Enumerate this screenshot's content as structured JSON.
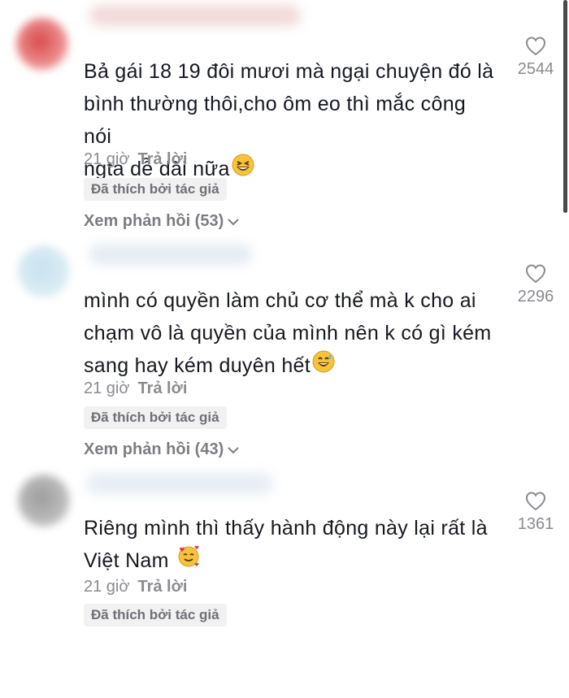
{
  "colors": {
    "text": "#161823",
    "muted": "#8a8b91",
    "badge_bg": "#f1f1f2",
    "badge_text": "#6f7076"
  },
  "comments": [
    {
      "text_lines": [
        "Bả gái 18 19 đôi mươi mà ngại chuyện đó là",
        "bình thường thôi,cho ôm eo thì mắc công nói",
        "ngta dễ dãi nữa"
      ],
      "emoji": "grinning-squinting-face",
      "time": "21 giờ",
      "reply_label": "Trả lời",
      "badge": "Đã thích bởi tác giả",
      "view_replies": "Xem phản hồi (53)",
      "likes": "2544",
      "avatar_color": "#e87070"
    },
    {
      "text_lines": [
        "mình có quyền làm chủ cơ thể mà k cho ai",
        "chạm vô là quyền của mình nên k có gì kém",
        "sang hay kém duyên hết"
      ],
      "emoji": "grinning-face-with-sweat",
      "time": "21 giờ",
      "reply_label": "Trả lời",
      "badge": "Đã thích bởi tác giả",
      "view_replies": "Xem phản hồi (43)",
      "likes": "2296",
      "avatar_color": "#b8d8e8"
    },
    {
      "text_lines": [
        "Riêng mình thì thấy hành động này lại rất là",
        "Việt Nam"
      ],
      "emoji": "smiling-face-with-hearts",
      "time": "21 giờ",
      "reply_label": "Trả lời",
      "badge": "Đã thích bởi tác giả",
      "likes": "1361",
      "avatar_color": "#b0b0b0"
    }
  ]
}
